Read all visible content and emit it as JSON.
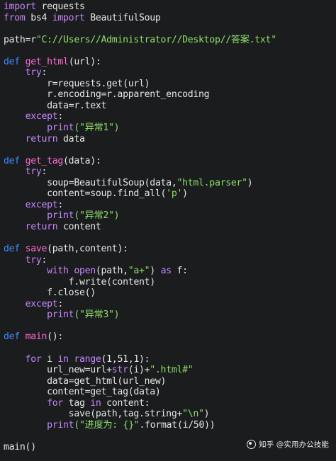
{
  "colors": {
    "background": "#1b1c1d",
    "text": "#e6e6e6",
    "keyword": "#c586ff",
    "def": "#3e8cff",
    "function": "#ff6bd6",
    "string": "#8dde6a"
  },
  "watermark": {
    "text": "知乎 @实用办公技能"
  },
  "code_lines": [
    {
      "tokens": [
        {
          "t": "kw",
          "v": "import"
        },
        {
          "t": "text",
          "v": " requests"
        }
      ]
    },
    {
      "tokens": [
        {
          "t": "kw",
          "v": "from"
        },
        {
          "t": "text",
          "v": " bs4 "
        },
        {
          "t": "kw",
          "v": "import"
        },
        {
          "t": "text",
          "v": " BeautifulSoup"
        }
      ]
    },
    {
      "tokens": []
    },
    {
      "tokens": [
        {
          "t": "text",
          "v": "path=r"
        },
        {
          "t": "str",
          "v": "\"C://Users//Administrator//Desktop//答案.txt\""
        }
      ]
    },
    {
      "tokens": []
    },
    {
      "tokens": [
        {
          "t": "def",
          "v": "def"
        },
        {
          "t": "text",
          "v": " "
        },
        {
          "t": "fn",
          "v": "get_html"
        },
        {
          "t": "text",
          "v": "(url):"
        }
      ]
    },
    {
      "tokens": [
        {
          "t": "text",
          "v": "    "
        },
        {
          "t": "kw",
          "v": "try"
        },
        {
          "t": "text",
          "v": ":"
        }
      ]
    },
    {
      "tokens": [
        {
          "t": "text",
          "v": "        r=requests.get(url)"
        }
      ]
    },
    {
      "tokens": [
        {
          "t": "text",
          "v": "        r.encoding=r.apparent_encoding"
        }
      ]
    },
    {
      "tokens": [
        {
          "t": "text",
          "v": "        data=r.text"
        }
      ]
    },
    {
      "tokens": [
        {
          "t": "text",
          "v": "    "
        },
        {
          "t": "kw",
          "v": "except"
        },
        {
          "t": "text",
          "v": ":"
        }
      ]
    },
    {
      "tokens": [
        {
          "t": "text",
          "v": "        "
        },
        {
          "t": "builtin",
          "v": "print"
        },
        {
          "t": "str",
          "v": "(\"异常1\")"
        }
      ]
    },
    {
      "tokens": [
        {
          "t": "text",
          "v": "    "
        },
        {
          "t": "kw",
          "v": "return"
        },
        {
          "t": "text",
          "v": " data"
        }
      ]
    },
    {
      "tokens": []
    },
    {
      "tokens": [
        {
          "t": "def",
          "v": "def"
        },
        {
          "t": "text",
          "v": " "
        },
        {
          "t": "fn",
          "v": "get_tag"
        },
        {
          "t": "text",
          "v": "(data):"
        }
      ]
    },
    {
      "tokens": [
        {
          "t": "text",
          "v": "    "
        },
        {
          "t": "kw",
          "v": "try"
        },
        {
          "t": "text",
          "v": ":"
        }
      ]
    },
    {
      "tokens": [
        {
          "t": "text",
          "v": "        soup=BeautifulSoup(data,"
        },
        {
          "t": "str",
          "v": "\"html.parser\""
        },
        {
          "t": "text",
          "v": ")"
        }
      ]
    },
    {
      "tokens": [
        {
          "t": "text",
          "v": "        content=soup.find_all("
        },
        {
          "t": "str",
          "v": "'p'"
        },
        {
          "t": "text",
          "v": ")"
        }
      ]
    },
    {
      "tokens": [
        {
          "t": "text",
          "v": "    "
        },
        {
          "t": "kw",
          "v": "except"
        },
        {
          "t": "text",
          "v": ":"
        }
      ]
    },
    {
      "tokens": [
        {
          "t": "text",
          "v": "        "
        },
        {
          "t": "builtin",
          "v": "print"
        },
        {
          "t": "str",
          "v": "(\"异常2\")"
        }
      ]
    },
    {
      "tokens": [
        {
          "t": "text",
          "v": "    "
        },
        {
          "t": "kw",
          "v": "return"
        },
        {
          "t": "text",
          "v": " content"
        }
      ]
    },
    {
      "tokens": []
    },
    {
      "tokens": [
        {
          "t": "def",
          "v": "def"
        },
        {
          "t": "text",
          "v": " "
        },
        {
          "t": "fn",
          "v": "save"
        },
        {
          "t": "text",
          "v": "(path,content):"
        }
      ]
    },
    {
      "tokens": [
        {
          "t": "text",
          "v": "    "
        },
        {
          "t": "kw",
          "v": "try"
        },
        {
          "t": "text",
          "v": ":"
        }
      ]
    },
    {
      "tokens": [
        {
          "t": "text",
          "v": "        "
        },
        {
          "t": "kw",
          "v": "with"
        },
        {
          "t": "text",
          "v": " "
        },
        {
          "t": "builtin",
          "v": "open"
        },
        {
          "t": "text",
          "v": "(path,"
        },
        {
          "t": "str",
          "v": "\"a+\""
        },
        {
          "t": "text",
          "v": ") "
        },
        {
          "t": "kw",
          "v": "as"
        },
        {
          "t": "text",
          "v": " f:"
        }
      ]
    },
    {
      "tokens": [
        {
          "t": "text",
          "v": "            f.write(content)"
        }
      ]
    },
    {
      "tokens": [
        {
          "t": "text",
          "v": "        f.close()"
        }
      ]
    },
    {
      "tokens": [
        {
          "t": "text",
          "v": "    "
        },
        {
          "t": "kw",
          "v": "except"
        },
        {
          "t": "text",
          "v": ":"
        }
      ]
    },
    {
      "tokens": [
        {
          "t": "text",
          "v": "        "
        },
        {
          "t": "builtin",
          "v": "print"
        },
        {
          "t": "str",
          "v": "(\"异常3\")"
        }
      ]
    },
    {
      "tokens": []
    },
    {
      "tokens": [
        {
          "t": "def",
          "v": "def"
        },
        {
          "t": "text",
          "v": " "
        },
        {
          "t": "fn",
          "v": "main"
        },
        {
          "t": "text",
          "v": "():"
        }
      ]
    },
    {
      "tokens": []
    },
    {
      "tokens": [
        {
          "t": "text",
          "v": "    "
        },
        {
          "t": "kw",
          "v": "for"
        },
        {
          "t": "text",
          "v": " i "
        },
        {
          "t": "kw",
          "v": "in"
        },
        {
          "t": "text",
          "v": " "
        },
        {
          "t": "builtin",
          "v": "range"
        },
        {
          "t": "text",
          "v": "(1,51,1):"
        }
      ]
    },
    {
      "tokens": [
        {
          "t": "text",
          "v": "        url_new=url+"
        },
        {
          "t": "builtin",
          "v": "str"
        },
        {
          "t": "text",
          "v": "(i)+"
        },
        {
          "t": "str",
          "v": "\".html#\""
        }
      ]
    },
    {
      "tokens": [
        {
          "t": "text",
          "v": "        data=get_html(url_new)"
        }
      ]
    },
    {
      "tokens": [
        {
          "t": "text",
          "v": "        content=get_tag(data)"
        }
      ]
    },
    {
      "tokens": [
        {
          "t": "text",
          "v": "        "
        },
        {
          "t": "kw",
          "v": "for"
        },
        {
          "t": "text",
          "v": " tag "
        },
        {
          "t": "kw",
          "v": "in"
        },
        {
          "t": "text",
          "v": " content:"
        }
      ]
    },
    {
      "tokens": [
        {
          "t": "text",
          "v": "            save(path,tag.string+"
        },
        {
          "t": "str",
          "v": "\"\\n\""
        },
        {
          "t": "text",
          "v": ")"
        }
      ]
    },
    {
      "tokens": [
        {
          "t": "text",
          "v": "        "
        },
        {
          "t": "builtin",
          "v": "print"
        },
        {
          "t": "str",
          "v": "(\"进度为: {}\""
        },
        {
          "t": "text",
          "v": ".format(i/50))"
        }
      ]
    },
    {
      "tokens": []
    },
    {
      "tokens": [
        {
          "t": "text",
          "v": "main()"
        }
      ]
    }
  ]
}
